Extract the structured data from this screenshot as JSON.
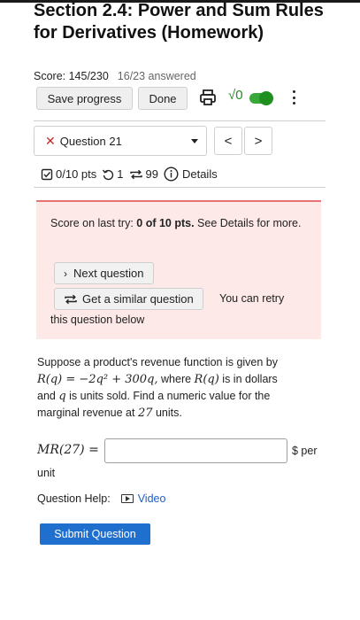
{
  "header": {
    "title": "Section 2.4: Power and Sum Rules for Derivatives (Homework)",
    "score_label": "Score: 145/230",
    "answered": "16/23 answered"
  },
  "toolbar": {
    "save_label": "Save progress",
    "done_label": "Done",
    "sqrt_label": "√0"
  },
  "question_nav": {
    "selected": "Question 21",
    "status_icon": "x-icon",
    "prev_label": "<",
    "next_label": ">"
  },
  "meta": {
    "points": "0/10 pts",
    "retries": "1",
    "similar": "99",
    "details_label": "Details"
  },
  "alert": {
    "score_prefix": "Score on last try: ",
    "score_value": "0 of 10 pts.",
    "score_suffix": " See Details for more.",
    "next_question_label": "Next question",
    "similar_label": "Get a similar question",
    "retry_text_a": "You can retry",
    "retry_text_b": "this question below"
  },
  "problem": {
    "text_1": "Suppose a product's revenue function is given by",
    "formula": "R(q) = −2q² + 300q,",
    "text_2": " where ",
    "rq": "R(q)",
    "text_3": " is in dollars",
    "text_4": "and ",
    "q": "q",
    "text_5": " is units sold. Find a numeric value for the",
    "text_6": "marginal revenue at ",
    "num": "27",
    "text_7": " units."
  },
  "answer": {
    "label": "MR(27) =",
    "value": "",
    "unit_a": "$ per",
    "unit_b": "unit"
  },
  "help": {
    "label": "Question Help:",
    "video_label": "Video"
  },
  "submit_label": "Submit Question",
  "colors": {
    "accent": "#1f6fcf",
    "toggle": "#38a838",
    "error": "#c62828",
    "alert_bg": "#fde9e7"
  }
}
